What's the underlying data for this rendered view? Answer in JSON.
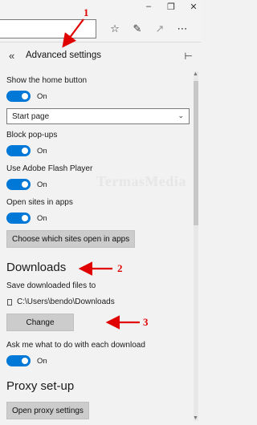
{
  "window_controls": [
    "minimize-icon",
    "restore-icon",
    "close-icon"
  ],
  "toolbar_icons": [
    "favorites-icon",
    "pen-icon",
    "share-icon",
    "more-icon"
  ],
  "panel": {
    "title": "Advanced settings",
    "back_icon": "double-chevron-left-icon",
    "pin_icon": "pin-icon"
  },
  "settings": {
    "home_button": {
      "label": "Show the home button",
      "state": "On"
    },
    "home_select": {
      "value": "Start page"
    },
    "popups": {
      "label": "Block pop-ups",
      "state": "On"
    },
    "flash": {
      "label": "Use Adobe Flash Player",
      "state": "On"
    },
    "open_in_apps": {
      "label": "Open sites in apps",
      "state": "On"
    },
    "choose_apps_button": "Choose which sites open in apps",
    "downloads": {
      "heading": "Downloads",
      "save_label": "Save downloaded files to",
      "path": "C:\\Users\\bendo\\Downloads",
      "change_button": "Change",
      "ask_label": "Ask me what to do with each download",
      "ask_state": "On"
    },
    "proxy": {
      "heading": "Proxy set-up",
      "open_button": "Open proxy settings"
    }
  },
  "annotations": {
    "one": "1",
    "two": "2",
    "three": "3"
  },
  "watermark": "TermasMedia",
  "colors": {
    "accent": "#0078d7",
    "annotation": "#e00000",
    "button": "#cccccc"
  }
}
